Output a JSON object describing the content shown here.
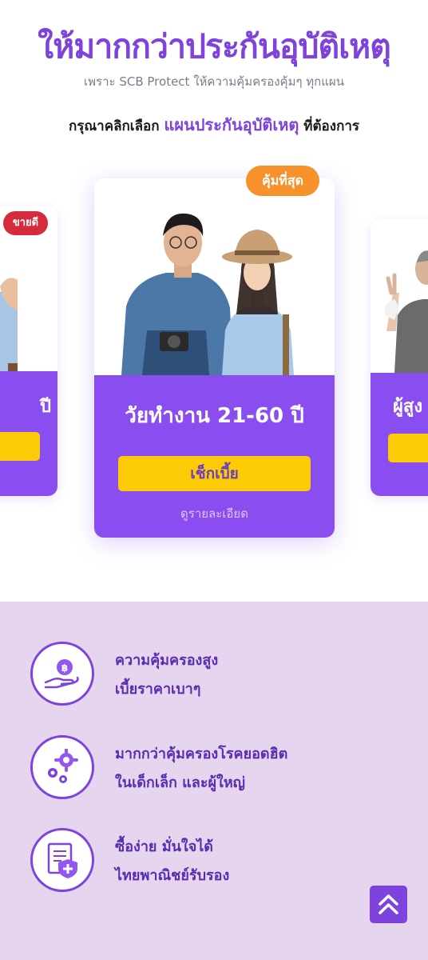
{
  "hero": {
    "title": "ให้มากกว่าประกันอุบัติเหตุ",
    "subtitle": "เพราะ SCB Protect ให้ความคุ้มครองคุ้มๆ ทุกแผน",
    "prompt_pre": "กรุณาคลิกเลือก ",
    "prompt_highlight": "แผนประกันอุบัติเหตุ",
    "prompt_post": " ที่ต้องการ"
  },
  "plans": {
    "left": {
      "badge": "ขายดี",
      "title": "ปี"
    },
    "main": {
      "badge": "คุ้มที่สุด",
      "title": "วัยทำงาน 21-60 ปี",
      "cta": "เช็กเบี้ย",
      "detail": "ดูรายละเอียด"
    },
    "right": {
      "title": "ผู้สูง"
    }
  },
  "features": [
    {
      "icon": "money-hand-icon",
      "line1": "ความคุ้มครองสูง",
      "line2": "เบี้ยราคาเบาๆ"
    },
    {
      "icon": "gears-icon",
      "line1": "มากกว่าคุ้มครองโรคยอดฮิต",
      "line2": "ในเด็กเล็ก และผู้ใหญ่"
    },
    {
      "icon": "document-shield-icon",
      "line1": "ซื้อง่าย มั่นใจได้",
      "line2": "ไทยพาณิชย์รับรอง"
    }
  ],
  "colors": {
    "brand": "#7d43dc",
    "panel": "#8a4df0",
    "cta": "#fccb05",
    "badge_best": "#f7912b",
    "badge_sale": "#d62b3c",
    "section_bg": "#e5d5ee"
  },
  "scroll_top_icon": "double-chevron-up-icon"
}
